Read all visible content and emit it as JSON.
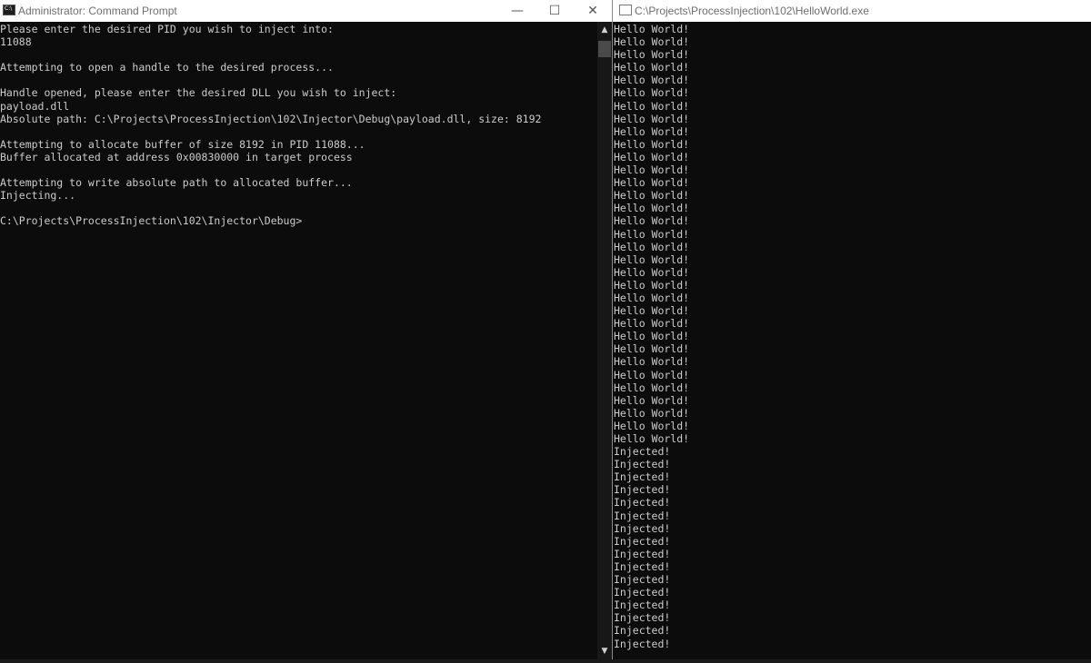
{
  "left_window": {
    "title": "Administrator: Command Prompt",
    "icon_text": "C:\\",
    "controls": {
      "minimize": "—",
      "maximize": "☐",
      "close": "✕"
    },
    "lines": [
      "Please enter the desired PID you wish to inject into:",
      "11088",
      "",
      "Attempting to open a handle to the desired process...",
      "",
      "Handle opened, please enter the desired DLL you wish to inject:",
      "payload.dll",
      "Absolute path: C:\\Projects\\ProcessInjection\\102\\Injector\\Debug\\payload.dll, size: 8192",
      "",
      "Attempting to allocate buffer of size 8192 in PID 11088...",
      "Buffer allocated at address 0x00830000 in target process",
      "",
      "Attempting to write absolute path to allocated buffer...",
      "Injecting...",
      "",
      "C:\\Projects\\ProcessInjection\\102\\Injector\\Debug>"
    ],
    "scrollbar": {
      "up": "▲",
      "down": "▼"
    }
  },
  "right_window": {
    "title": "C:\\Projects\\ProcessInjection\\102\\HelloWorld.exe",
    "lines": [
      "Hello World!",
      "Hello World!",
      "Hello World!",
      "Hello World!",
      "Hello World!",
      "Hello World!",
      "Hello World!",
      "Hello World!",
      "Hello World!",
      "Hello World!",
      "Hello World!",
      "Hello World!",
      "Hello World!",
      "Hello World!",
      "Hello World!",
      "Hello World!",
      "Hello World!",
      "Hello World!",
      "Hello World!",
      "Hello World!",
      "Hello World!",
      "Hello World!",
      "Hello World!",
      "Hello World!",
      "Hello World!",
      "Hello World!",
      "Hello World!",
      "Hello World!",
      "Hello World!",
      "Hello World!",
      "Hello World!",
      "Hello World!",
      "Hello World!",
      "Injected!",
      "Injected!",
      "Injected!",
      "Injected!",
      "Injected!",
      "Injected!",
      "Injected!",
      "Injected!",
      "Injected!",
      "Injected!",
      "Injected!",
      "Injected!",
      "Injected!",
      "Injected!",
      "Injected!",
      "Injected!"
    ]
  }
}
